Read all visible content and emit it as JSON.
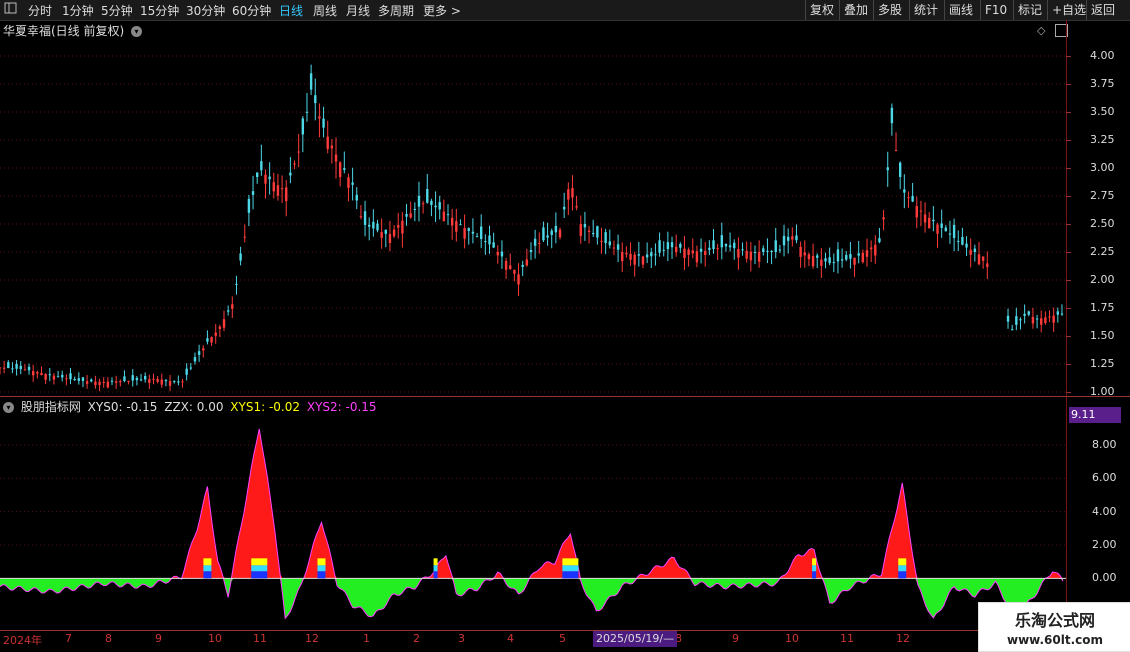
{
  "toolbar": {
    "tabs": [
      {
        "label": "分时"
      },
      {
        "label": "1分钟"
      },
      {
        "label": "5分钟"
      },
      {
        "label": "15分钟"
      },
      {
        "label": "30分钟"
      },
      {
        "label": "60分钟"
      },
      {
        "label": "日线",
        "active": true
      },
      {
        "label": "周线"
      },
      {
        "label": "月线"
      },
      {
        "label": "多周期"
      },
      {
        "label": "更多 >"
      }
    ],
    "actions": [
      {
        "label": "复权"
      },
      {
        "label": "叠加"
      },
      {
        "label": "多股"
      },
      {
        "label": "统计"
      },
      {
        "label": "画线"
      },
      {
        "label": "F10"
      },
      {
        "label": "标记"
      },
      {
        "label": "+自选"
      },
      {
        "label": "返回"
      }
    ]
  },
  "stock": {
    "title": "华夏幸福(日线 前复权)"
  },
  "indicator": {
    "name": "股朋指标网",
    "xys0": "XYS0: -0.15",
    "zzx": "ZZX: 0.00",
    "xys1": "XYS1: -0.02",
    "xys2": "XYS2: -0.15",
    "last_value": "9.11",
    "colors": {
      "xys1": "#ffff00",
      "xys2": "#ff40ff",
      "positive": "#ff1a1a",
      "negative": "#22ee22"
    }
  },
  "price_axis": [
    "4.00",
    "3.75",
    "3.50",
    "3.25",
    "3.00",
    "2.75",
    "2.50",
    "2.25",
    "2.00",
    "1.75",
    "1.50",
    "1.25",
    "1.00"
  ],
  "indicator_axis": [
    "8.00",
    "6.00",
    "4.00",
    "2.00",
    "0.00"
  ],
  "time_axis": [
    "2024年",
    "7",
    "8",
    "9",
    "10",
    "11",
    "12",
    "1",
    "2",
    "3",
    "4",
    "5",
    "7",
    "8",
    "9",
    "10",
    "11",
    "12"
  ],
  "date_highlight": "2025/05/19/—",
  "watermark": {
    "name": "乐淘公式网",
    "url": "www.60lt.com"
  },
  "chart_data": {
    "type": "candlestick",
    "price_ylim": [
      1.0,
      4.0
    ],
    "price_trend": [
      [
        0,
        1.22
      ],
      [
        5,
        1.2
      ],
      [
        10,
        1.15
      ],
      [
        15,
        1.1
      ],
      [
        20,
        1.09
      ],
      [
        25,
        1.1
      ],
      [
        30,
        1.12
      ],
      [
        35,
        1.08
      ],
      [
        40,
        1.45
      ],
      [
        42,
        1.55
      ],
      [
        45,
        1.8
      ],
      [
        48,
        2.6
      ],
      [
        50,
        3.0
      ],
      [
        52,
        2.9
      ],
      [
        55,
        2.8
      ],
      [
        58,
        3.2
      ],
      [
        60,
        3.7
      ],
      [
        62,
        3.4
      ],
      [
        65,
        3.1
      ],
      [
        68,
        2.85
      ],
      [
        70,
        2.5
      ],
      [
        75,
        2.4
      ],
      [
        78,
        2.55
      ],
      [
        82,
        2.7
      ],
      [
        86,
        2.6
      ],
      [
        90,
        2.45
      ],
      [
        95,
        2.3
      ],
      [
        100,
        2.05
      ],
      [
        103,
        2.3
      ],
      [
        108,
        2.45
      ],
      [
        110,
        2.9
      ],
      [
        112,
        2.5
      ],
      [
        116,
        2.35
      ],
      [
        120,
        2.25
      ],
      [
        125,
        2.2
      ],
      [
        130,
        2.3
      ],
      [
        135,
        2.25
      ],
      [
        140,
        2.3
      ],
      [
        145,
        2.25
      ],
      [
        150,
        2.25
      ],
      [
        153,
        2.4
      ],
      [
        155,
        2.25
      ],
      [
        160,
        2.15
      ],
      [
        165,
        2.2
      ],
      [
        170,
        2.35
      ],
      [
        172,
        3.4
      ],
      [
        174,
        2.8
      ],
      [
        178,
        2.6
      ],
      [
        182,
        2.45
      ],
      [
        186,
        2.3
      ],
      [
        190,
        2.2
      ],
      [
        195,
        1.55
      ],
      [
        198,
        1.7
      ],
      [
        200,
        1.65
      ],
      [
        205,
        1.7
      ]
    ],
    "indicator_ylim": [
      -2.5,
      9.5
    ],
    "indicator_trend": [
      [
        0,
        -0.5
      ],
      [
        10,
        -0.8
      ],
      [
        20,
        -0.3
      ],
      [
        28,
        -0.5
      ],
      [
        35,
        0.1
      ],
      [
        38,
        3.0
      ],
      [
        40,
        5.4
      ],
      [
        42,
        1.0
      ],
      [
        44,
        -1.0
      ],
      [
        47,
        4.0
      ],
      [
        50,
        9.11
      ],
      [
        53,
        3.0
      ],
      [
        55,
        -2.5
      ],
      [
        58,
        -0.5
      ],
      [
        62,
        3.5
      ],
      [
        65,
        -0.3
      ],
      [
        68,
        -1.6
      ],
      [
        72,
        -2.3
      ],
      [
        76,
        -1.0
      ],
      [
        80,
        -0.5
      ],
      [
        84,
        0.5
      ],
      [
        86,
        1.5
      ],
      [
        88,
        -1.0
      ],
      [
        92,
        -0.6
      ],
      [
        96,
        0.3
      ],
      [
        100,
        -1.0
      ],
      [
        104,
        0.7
      ],
      [
        107,
        1.0
      ],
      [
        110,
        2.8
      ],
      [
        112,
        -0.2
      ],
      [
        115,
        -2.0
      ],
      [
        120,
        -0.5
      ],
      [
        130,
        1.2
      ],
      [
        134,
        -0.3
      ],
      [
        140,
        -0.5
      ],
      [
        150,
        -0.3
      ],
      [
        154,
        1.4
      ],
      [
        157,
        1.7
      ],
      [
        160,
        -1.5
      ],
      [
        164,
        -0.5
      ],
      [
        170,
        0.3
      ],
      [
        174,
        5.6
      ],
      [
        177,
        -0.5
      ],
      [
        180,
        -2.5
      ],
      [
        184,
        -0.5
      ],
      [
        188,
        -1.0
      ],
      [
        192,
        -0.3
      ],
      [
        196,
        -2.4
      ],
      [
        200,
        -0.8
      ],
      [
        203,
        0.5
      ],
      [
        205,
        -0.15
      ]
    ]
  }
}
